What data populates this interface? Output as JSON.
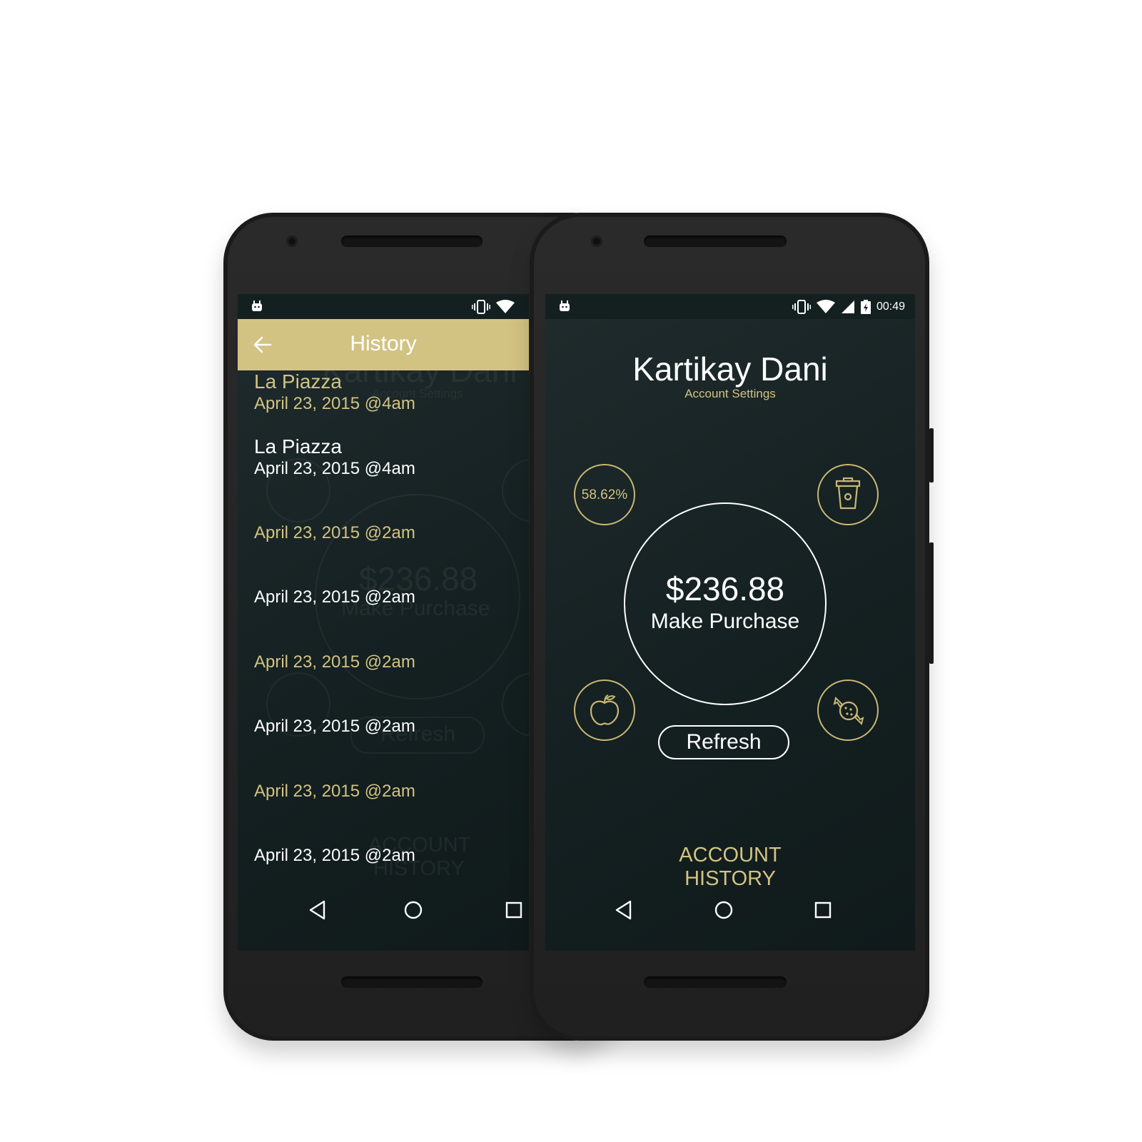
{
  "left_screen": {
    "appbar": {
      "title": "History",
      "back_icon": "arrow-left-icon"
    },
    "items": [
      {
        "title": "La Piazza",
        "date": "April 23, 2015 @4am",
        "tone": "gold"
      },
      {
        "title": "La Piazza",
        "date": "April 23, 2015 @4am",
        "tone": "white"
      },
      {
        "title": "",
        "date": "April 23, 2015 @2am",
        "tone": "gold"
      },
      {
        "title": "",
        "date": "April 23, 2015 @2am",
        "tone": "white"
      },
      {
        "title": "",
        "date": "April 23, 2015 @2am",
        "tone": "gold"
      },
      {
        "title": "",
        "date": "April 23, 2015 @2am",
        "tone": "white"
      },
      {
        "title": "",
        "date": "April 23, 2015 @2am",
        "tone": "gold"
      },
      {
        "title": "",
        "date": "April 23, 2015 @2am",
        "tone": "white"
      }
    ],
    "ghost": {
      "name": "Kartikay Dani",
      "settings": "Account Settings",
      "balance": "$236.88",
      "purchase": "Make Purchase",
      "refresh": "Refresh",
      "account": "ACCOUNT",
      "history": "HISTORY"
    }
  },
  "right_screen": {
    "status": {
      "time": "00:49"
    },
    "user_name": "Kartikay Dani",
    "account_settings": "Account Settings",
    "percentage": "58.62%",
    "balance": "$236.88",
    "make_purchase": "Make Purchase",
    "refresh": "Refresh",
    "footer": {
      "line1": "ACCOUNT",
      "line2": "HISTORY"
    },
    "category_icons": [
      "cup-icon",
      "apple-icon",
      "candy-icon"
    ]
  },
  "colors": {
    "accent": "#d2c383",
    "screen_bg": "#172324",
    "text": "#ffffff"
  }
}
